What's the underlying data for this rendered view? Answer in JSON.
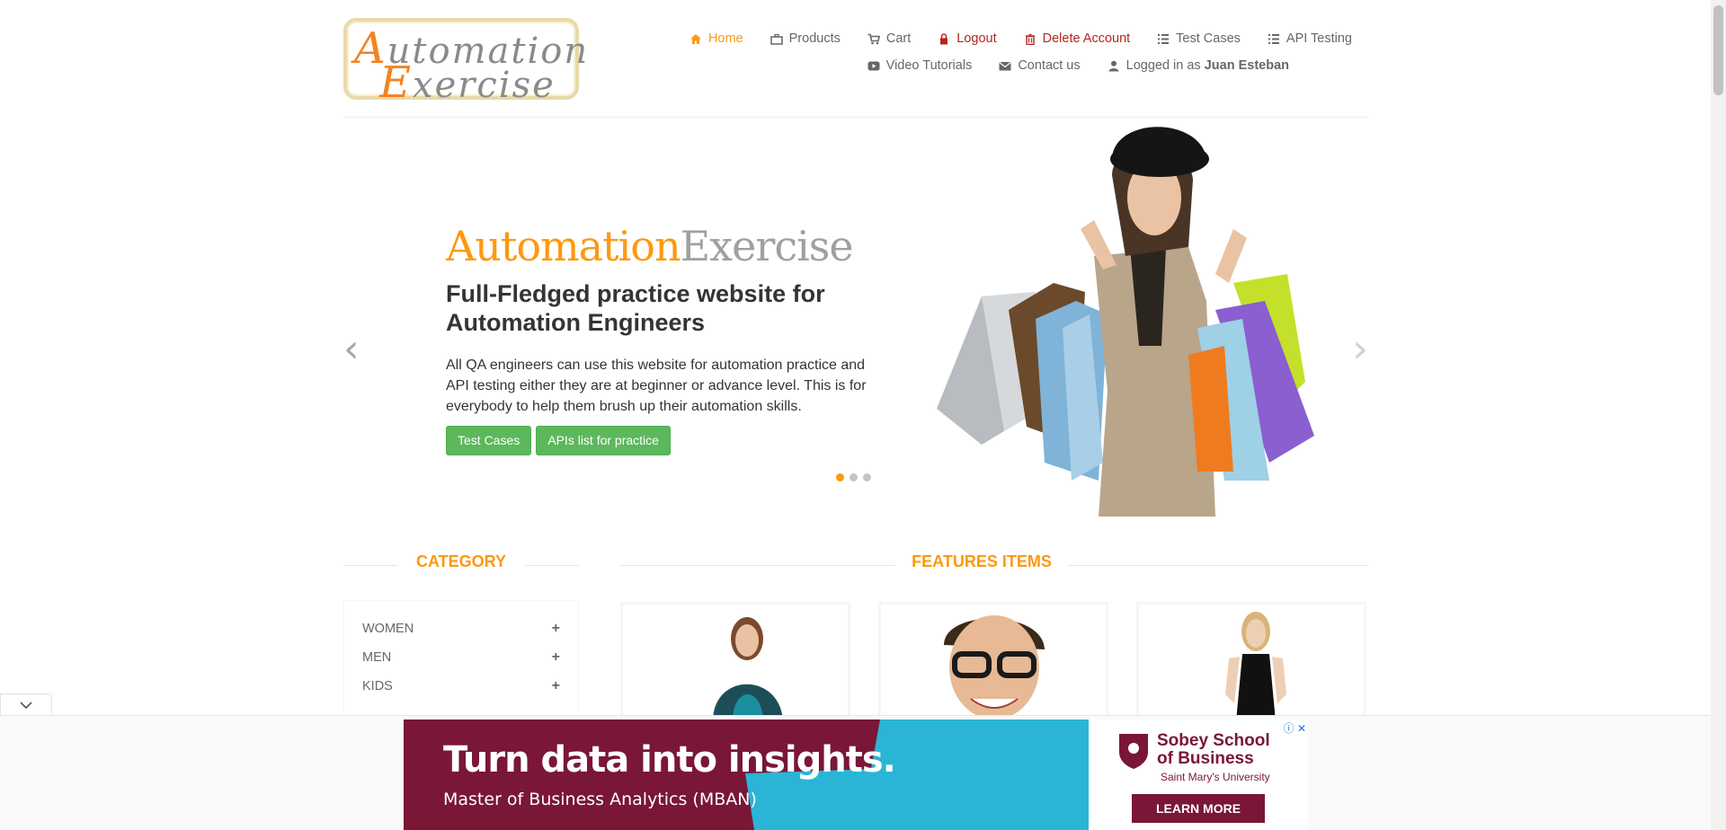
{
  "logo": {
    "line1_cap": "A",
    "line1_rest": "utomation",
    "line2_cap": "E",
    "line2_rest": "xercise"
  },
  "nav": {
    "row1": [
      {
        "icon": "home-icon",
        "label": "Home",
        "state": "active"
      },
      {
        "icon": "briefcase-icon",
        "label": "Products"
      },
      {
        "icon": "cart-icon",
        "label": "Cart"
      },
      {
        "icon": "lock-icon",
        "label": "Logout",
        "state": "red"
      },
      {
        "icon": "trash-icon",
        "label": "Delete Account",
        "state": "red"
      },
      {
        "icon": "list-icon",
        "label": "Test Cases"
      },
      {
        "icon": "list-icon",
        "label": "API Testing"
      }
    ],
    "row2": [
      {
        "icon": "youtube-icon",
        "label": "Video Tutorials"
      },
      {
        "icon": "envelope-icon",
        "label": "Contact us"
      },
      {
        "icon": "user-icon",
        "label": "Logged in as ",
        "user": "Juan Esteban"
      }
    ]
  },
  "hero": {
    "brand_a": "Automation",
    "brand_b": "Exercise",
    "heading": "Full-Fledged practice website for Automation Engineers",
    "paragraph": "All QA engineers can use this website for automation practice and API testing either they are at beginner or advance level. This is for everybody to help them brush up their automation skills.",
    "btn_test_cases": "Test Cases",
    "btn_apis": "APIs list for practice",
    "prev_arrow": "‹",
    "next_arrow": "›",
    "active_slide": 1,
    "slide_count": 3
  },
  "category": {
    "title": "CATEGORY",
    "items": [
      {
        "label": "WOMEN",
        "toggle": "+"
      },
      {
        "label": "MEN",
        "toggle": "+"
      },
      {
        "label": "KIDS",
        "toggle": "+"
      }
    ]
  },
  "features": {
    "title": "FEATURES ITEMS"
  },
  "ad": {
    "headline": "Turn data into insights.",
    "subline": "Master of Business Analytics (MBAN)",
    "org_line1": "Sobey School",
    "org_line2": "of Business",
    "org_uni": "Saint Mary's University",
    "cta": "LEARN MORE",
    "close": "ⓘ ✕"
  },
  "colors": {
    "accent": "#fe980f",
    "button_green": "#5cb85c",
    "danger": "#b3261e",
    "ad_teal": "#2ab5d6",
    "ad_maroon": "#7a1636"
  }
}
